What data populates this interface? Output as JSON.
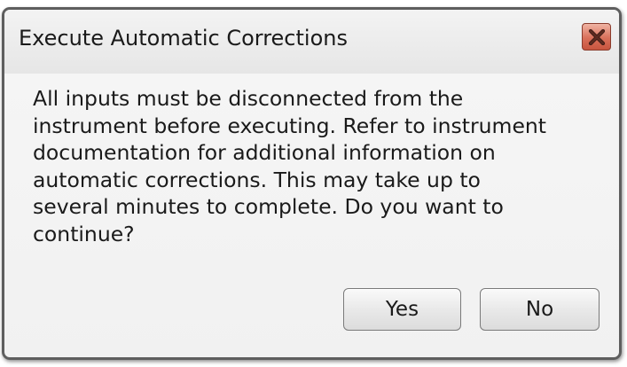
{
  "dialog": {
    "title": "Execute Automatic Corrections",
    "close_icon": "close-x-icon",
    "message_lines": [
      "All inputs must be disconnected from the",
      "instrument before executing.  Refer to instrument",
      "documentation for additional information on",
      "automatic corrections.  This may take up to",
      "several minutes to complete.  Do you want to",
      "continue?"
    ],
    "buttons": {
      "yes_label": "Yes",
      "no_label": "No"
    }
  },
  "colors": {
    "close_button": "#d9705a",
    "border": "#5e5e5e"
  }
}
